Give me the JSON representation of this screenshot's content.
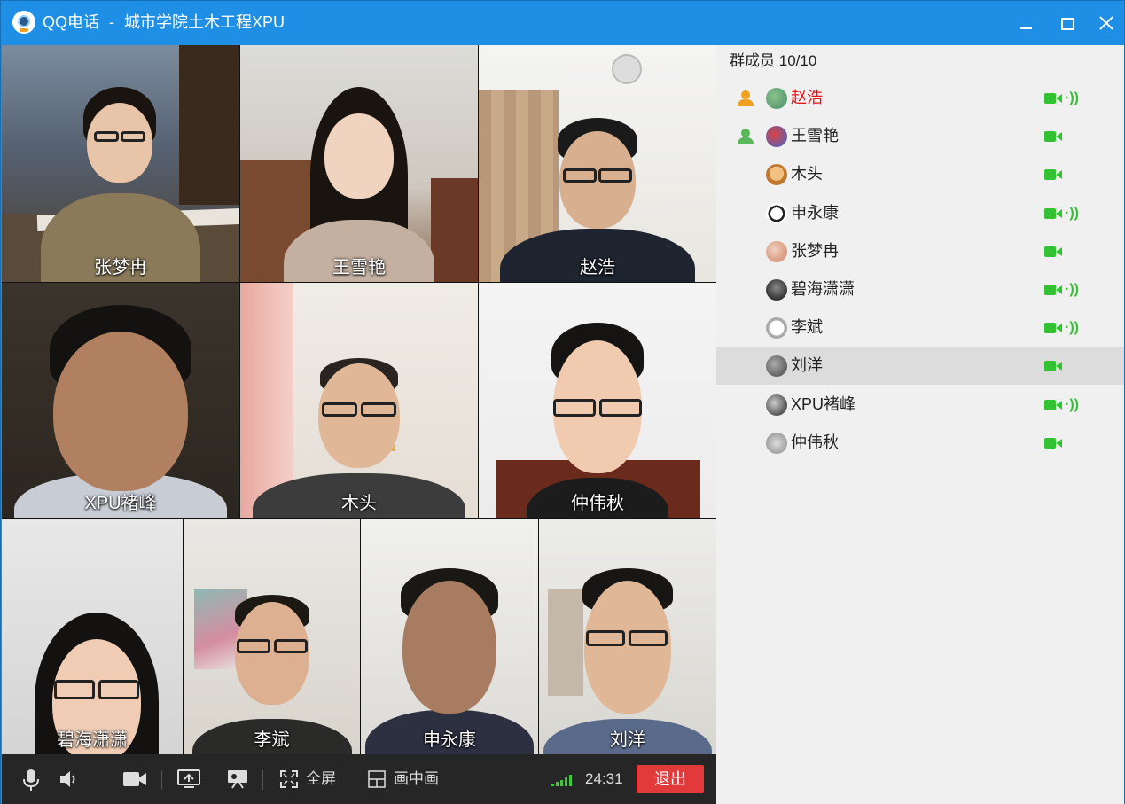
{
  "window": {
    "app_name": "QQ电话",
    "separator": "-",
    "group_name": "城市学院土木工程XPU"
  },
  "video_tiles": [
    {
      "name": "张梦冉"
    },
    {
      "name": "王雪艳"
    },
    {
      "name": "赵浩"
    },
    {
      "name": "XPU褚峰"
    },
    {
      "name": "木头"
    },
    {
      "name": "仲伟秋"
    },
    {
      "name": "碧海潇潇"
    },
    {
      "name": "李斌"
    },
    {
      "name": "申永康"
    },
    {
      "name": "刘洋"
    }
  ],
  "toolbar": {
    "fullscreen_label": "全屏",
    "pip_label": "画中画",
    "timer": "24:31",
    "exit_label": "退出",
    "accent_green": "#3ec83e",
    "exit_color": "#e2393b"
  },
  "panel": {
    "header_label": "群成员",
    "member_count": "10/10",
    "members": [
      {
        "name": "赵浩",
        "admin": true,
        "highlight": true,
        "camera": true,
        "speaking": true,
        "selected": false
      },
      {
        "name": "王雪艳",
        "admin": true,
        "highlight": false,
        "camera": true,
        "speaking": false,
        "selected": false
      },
      {
        "name": "木头",
        "admin": false,
        "highlight": false,
        "camera": true,
        "speaking": false,
        "selected": false
      },
      {
        "name": "申永康",
        "admin": false,
        "highlight": false,
        "camera": true,
        "speaking": true,
        "selected": false
      },
      {
        "name": "张梦冉",
        "admin": false,
        "highlight": false,
        "camera": true,
        "speaking": false,
        "selected": false
      },
      {
        "name": "碧海潇潇",
        "admin": false,
        "highlight": false,
        "camera": true,
        "speaking": true,
        "selected": false
      },
      {
        "name": "李斌",
        "admin": false,
        "highlight": false,
        "camera": true,
        "speaking": true,
        "selected": false
      },
      {
        "name": "刘洋",
        "admin": false,
        "highlight": false,
        "camera": true,
        "speaking": false,
        "selected": true
      },
      {
        "name": "XPU褚峰",
        "admin": false,
        "highlight": false,
        "camera": true,
        "speaking": true,
        "selected": false
      },
      {
        "name": "仲伟秋",
        "admin": false,
        "highlight": false,
        "camera": true,
        "speaking": false,
        "selected": false
      }
    ]
  }
}
